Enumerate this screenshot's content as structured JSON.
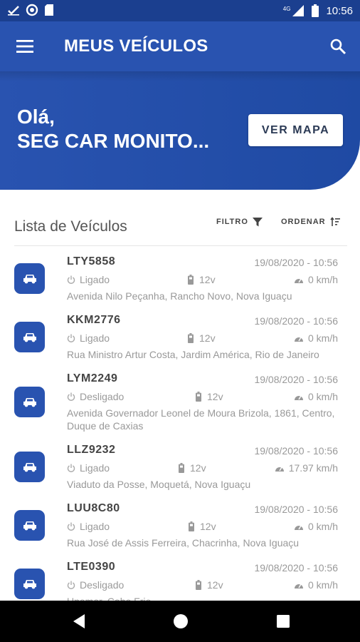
{
  "status_bar": {
    "time": "10:56",
    "network_label": "4G",
    "icons": [
      "check-icon",
      "circle-icon",
      "sd-card-icon",
      "signal-icon",
      "battery-icon"
    ]
  },
  "app_bar": {
    "title": "MEUS VEÍCULOS",
    "icons": [
      "menu-icon",
      "search-icon"
    ]
  },
  "hero": {
    "greeting_line1": "Olá,",
    "greeting_line2": "SEG CAR MONITO...",
    "map_button_label": "VER MAPA"
  },
  "list": {
    "title": "Lista de Veículos",
    "filter_label": "FILTRO",
    "order_label": "ORDENAR"
  },
  "vehicles": [
    {
      "plate": "LTY5858",
      "datetime": "19/08/2020 - 10:56",
      "ignition": "Ligado",
      "voltage": "12v",
      "speed": "0 km/h",
      "address": "Avenida Nilo Peçanha, Rancho Novo, Nova Iguaçu"
    },
    {
      "plate": "KKM2776",
      "datetime": "19/08/2020 - 10:56",
      "ignition": "Ligado",
      "voltage": "12v",
      "speed": "0 km/h",
      "address": "Rua Ministro Artur Costa, Jardim América, Rio de Janeiro"
    },
    {
      "plate": "LYM2249",
      "datetime": "19/08/2020 - 10:56",
      "ignition": "Desligado",
      "voltage": "12v",
      "speed": "0 km/h",
      "address": "Avenida Governador Leonel de Moura Brizola, 1861, Centro, Duque de Caxias"
    },
    {
      "plate": "LLZ9232",
      "datetime": "19/08/2020 - 10:56",
      "ignition": "Ligado",
      "voltage": "12v",
      "speed": "17.97 km/h",
      "address": "Viaduto da Posse, Moquetá, Nova Iguaçu"
    },
    {
      "plate": "LUU8C80",
      "datetime": "19/08/2020 - 10:56",
      "ignition": "Ligado",
      "voltage": "12v",
      "speed": "0 km/h",
      "address": "Rua José de Assis Ferreira, Chacrinha, Nova Iguaçu"
    },
    {
      "plate": "LTE0390",
      "datetime": "19/08/2020 - 10:56",
      "ignition": "Desligado",
      "voltage": "12v",
      "speed": "0 km/h",
      "address": "Unamar, Cabo Frio"
    }
  ],
  "colors": {
    "primary": "#2953b0",
    "status_bar": "#1b3f8f",
    "text_muted": "#999999",
    "text_dark": "#444444"
  }
}
